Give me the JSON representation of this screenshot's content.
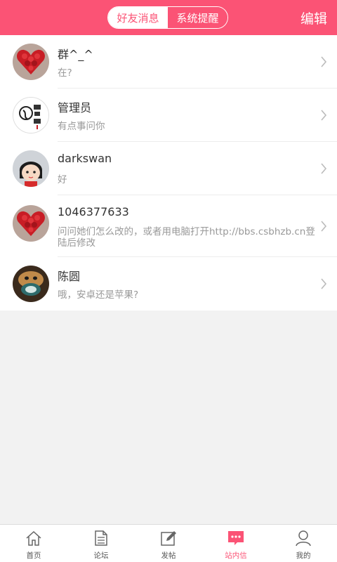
{
  "header": {
    "tabs": [
      {
        "label": "好友消息",
        "active": true
      },
      {
        "label": "系统提醒",
        "active": false
      }
    ],
    "edit_label": "编辑"
  },
  "messages": [
    {
      "name": "群^_^",
      "preview": "在?",
      "avatar": "red-roses-heart-avatar"
    },
    {
      "name": "管理员",
      "preview": "有点事问你",
      "avatar": "calligraphy-logo-avatar"
    },
    {
      "name": "darkswan",
      "preview": "好",
      "avatar": "cartoon-girl-avatar"
    },
    {
      "name": "1046377633",
      "preview": "问问她们怎么改的，或者用电脑打开http://bbs.csbhzb.cn登陆后修改",
      "avatar": "red-roses-heart-avatar"
    },
    {
      "name": "陈圆",
      "preview": "哦，安卓还是苹果?",
      "avatar": "dog-photo-avatar"
    }
  ],
  "tabbar": {
    "items": [
      {
        "label": "首页",
        "icon": "home-icon",
        "active": false
      },
      {
        "label": "论坛",
        "icon": "document-icon",
        "active": false
      },
      {
        "label": "发帖",
        "icon": "compose-icon",
        "active": false
      },
      {
        "label": "站内信",
        "icon": "message-icon",
        "active": true
      },
      {
        "label": "我的",
        "icon": "person-icon",
        "active": false
      }
    ]
  },
  "colors": {
    "accent": "#fb5375",
    "background": "#f2f2f2"
  }
}
